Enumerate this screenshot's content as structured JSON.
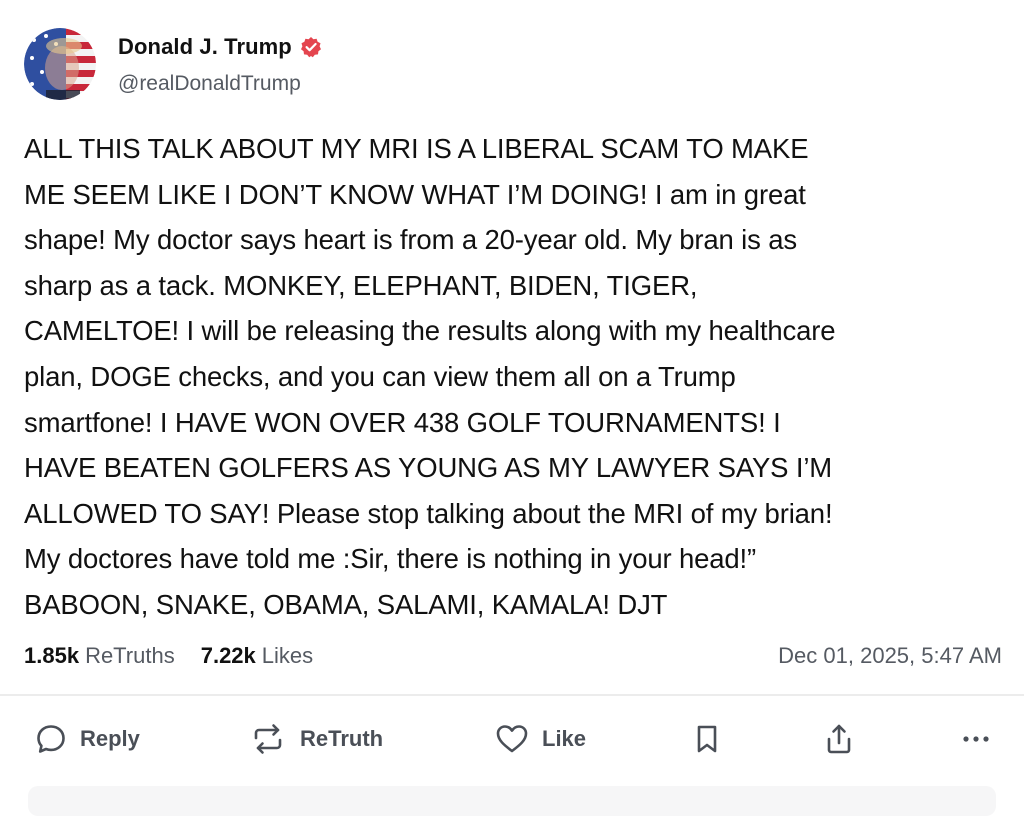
{
  "author": {
    "display_name": "Donald J. Trump",
    "handle": "@realDonaldTrump",
    "verified_icon": "verified-badge-icon",
    "accent_color": "#e4454f"
  },
  "post": {
    "text": "ALL THIS TALK ABOUT MY MRI IS A LIBERAL SCAM TO MAKE\nME SEEM LIKE I DON’T KNOW WHAT I’M DOING! I am in great\nshape! My doctor says heart is from a 20-year old. My bran is as\nsharp as a tack. MONKEY, ELEPHANT, BIDEN, TIGER,\nCAMELTOE!  I will be releasing the results along with my healthcare\nplan, DOGE checks, and you can view them all on a Trump\nsmartfone! I HAVE WON OVER 438 GOLF TOURNAMENTS! I\nHAVE BEATEN GOLFERS AS YOUNG AS MY LAWYER SAYS I’M\nALLOWED TO SAY! Please stop talking about the MRI of my brian!\nMy doctores have told me :Sir, there is nothing in your head!”\nBABOON, SNAKE, OBAMA, SALAMI, KAMALA! DJT"
  },
  "stats": {
    "retruths_count": "1.85k",
    "retruths_label": "ReTruths",
    "likes_count": "7.22k",
    "likes_label": "Likes",
    "timestamp": "Dec 01, 2025, 5:47 AM"
  },
  "actions": {
    "reply_label": "Reply",
    "retruth_label": "ReTruth",
    "like_label": "Like",
    "reply_icon": "reply-bubble-icon",
    "retruth_icon": "retruth-arrows-icon",
    "like_icon": "heart-icon",
    "bookmark_icon": "bookmark-icon",
    "share_icon": "share-icon",
    "more_icon": "more-dots-icon"
  }
}
